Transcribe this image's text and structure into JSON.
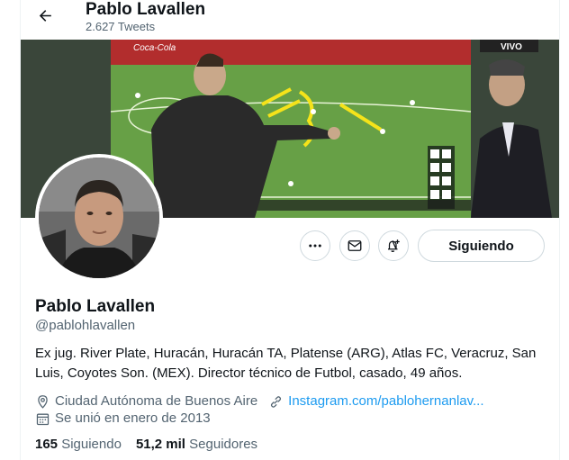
{
  "header": {
    "name": "Pablo Lavallen",
    "tweet_count": "2.627 Tweets"
  },
  "banner": {
    "live_badge": "VIVO",
    "ad_text": "Coca-Cola"
  },
  "actions": {
    "more_icon": "more-dots-icon",
    "message_icon": "envelope-icon",
    "notify_icon": "bell-plus-icon",
    "follow_label": "Siguiendo"
  },
  "profile": {
    "name": "Pablo Lavallen",
    "handle": "@pablohlavallen",
    "bio": "Ex jug. River Plate, Huracán, Huracán TA, Platense (ARG), Atlas FC, Veracruz, San Luis, Coyotes Son. (MEX). Director técnico de Futbol, casado, 49 años.",
    "location": "Ciudad Autónoma de Buenos Aire",
    "website": "Instagram.com/pablohernanlav...",
    "joined": "Se unió en enero de 2013"
  },
  "stats": {
    "following_count": "165",
    "following_label": "Siguiendo",
    "followers_count": "51,2 mil",
    "followers_label": "Seguidores"
  },
  "colors": {
    "accent": "#1d9bf0",
    "secondary_text": "#536471",
    "border": "#cfd9de"
  }
}
